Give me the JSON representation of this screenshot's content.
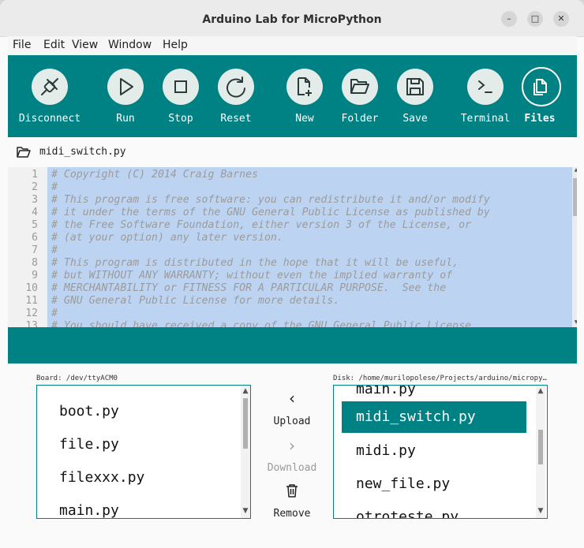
{
  "window": {
    "title": "Arduino Lab for MicroPython",
    "controls": {
      "minimize": "–",
      "maximize": "□",
      "close": "✕"
    }
  },
  "menu": [
    "File",
    "Edit",
    "View",
    "Window",
    "Help"
  ],
  "toolbar": {
    "buttons": [
      {
        "label": "Disconnect",
        "icon": "disconnect-plug-icon"
      },
      {
        "label": "Run",
        "icon": "play-icon"
      },
      {
        "label": "Stop",
        "icon": "stop-square-icon"
      },
      {
        "label": "Reset",
        "icon": "reset-arrow-icon"
      },
      {
        "label": "New",
        "icon": "new-file-icon"
      },
      {
        "label": "Folder",
        "icon": "folder-open-icon"
      },
      {
        "label": "Save",
        "icon": "save-disk-icon"
      },
      {
        "label": "Terminal",
        "icon": "terminal-prompt-icon"
      },
      {
        "label": "Files",
        "icon": "files-icon",
        "selected": true
      }
    ],
    "colors": {
      "bar": "#008184",
      "button": "#e4ece9"
    }
  },
  "file_bar": {
    "filename": "midi_switch.py",
    "icon": "folder-open-icon"
  },
  "editor": {
    "lines": [
      {
        "n": "1",
        "text": "# Copyright (C) 2014 Craig Barnes"
      },
      {
        "n": "2",
        "text": "#"
      },
      {
        "n": "3",
        "text": "# This program is free software: you can redistribute it and/or modify"
      },
      {
        "n": "4",
        "text": "# it under the terms of the GNU General Public License as published by"
      },
      {
        "n": "5",
        "text": "# the Free Software Foundation, either version 3 of the License, or"
      },
      {
        "n": "6",
        "text": "# (at your option) any later version."
      },
      {
        "n": "7",
        "text": "#"
      },
      {
        "n": "8",
        "text": "# This program is distributed in the hope that it will be useful,"
      },
      {
        "n": "9",
        "text": "# but WITHOUT ANY WARRANTY; without even the implied warranty of"
      },
      {
        "n": "10",
        "text": "# MERCHANTABILITY or FITNESS FOR A PARTICULAR PURPOSE.  See the"
      },
      {
        "n": "11",
        "text": "# GNU General Public License for more details."
      },
      {
        "n": "12",
        "text": "#"
      },
      {
        "n": "13",
        "text": "# You should have received a copy of the GNU General Public License"
      }
    ]
  },
  "board": {
    "label": "Board: /dev/ttyACM0",
    "files": [
      "boot.py",
      "file.py",
      "filexxx.py",
      "main.py"
    ]
  },
  "disk": {
    "label": "Disk: /home/murilopolese/Projects/arduino/micropy…",
    "files": [
      "main.py",
      "midi_switch.py",
      "midi.py",
      "new_file.py",
      "otroteste.py"
    ],
    "selected": "midi_switch.py"
  },
  "transfer": {
    "upload": {
      "label": "Upload",
      "icon": "chevron-left-icon"
    },
    "download": {
      "label": "Download",
      "icon": "chevron-right-icon"
    },
    "remove": {
      "label": "Remove",
      "icon": "trash-icon"
    }
  },
  "scroll_glyphs": {
    "up": "▲",
    "down": "▼"
  },
  "glyphs": {
    "left": "‹",
    "right": "›",
    "trash": "🗑"
  }
}
